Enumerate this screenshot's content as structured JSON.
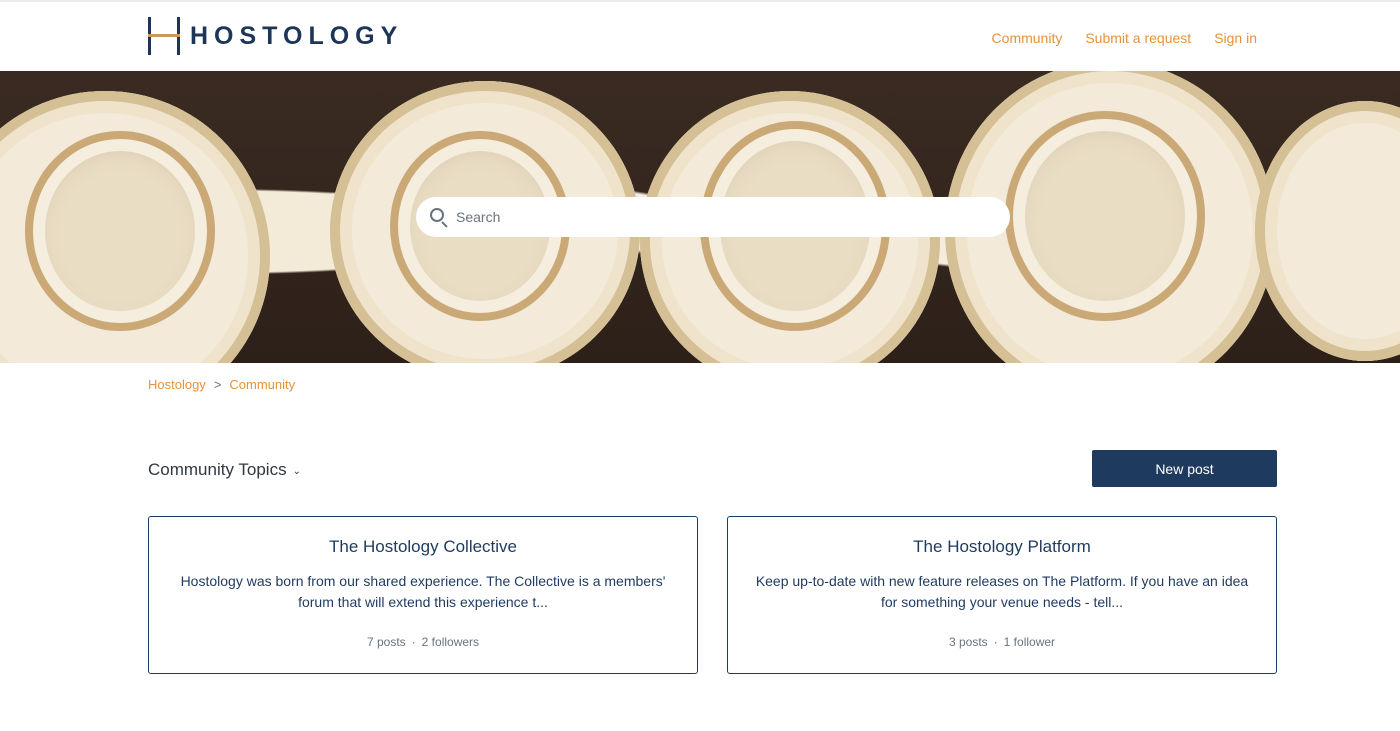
{
  "brand": {
    "name": "HOSTOLOGY"
  },
  "nav": {
    "community": "Community",
    "submit": "Submit a request",
    "signin": "Sign in"
  },
  "search": {
    "placeholder": "Search"
  },
  "breadcrumb": {
    "home": "Hostology",
    "separator": ">",
    "current": "Community"
  },
  "topics": {
    "label": "Community Topics"
  },
  "actions": {
    "new_post": "New post"
  },
  "cards": [
    {
      "title": "The Hostology Collective",
      "description": "Hostology was born from our shared experience. The Collective is a members' forum that will extend this experience t...",
      "posts": "7 posts",
      "followers": "2 followers"
    },
    {
      "title": "The Hostology Platform",
      "description": "Keep up-to-date with new feature releases on The Platform. If you have an idea for something your venue needs - tell...",
      "posts": "3 posts",
      "followers": "1 follower"
    }
  ],
  "meta_separator": "·",
  "colors": {
    "accent": "#e8913b",
    "primary": "#1f3a5f",
    "text": "#2f3941",
    "muted": "#68737d"
  }
}
